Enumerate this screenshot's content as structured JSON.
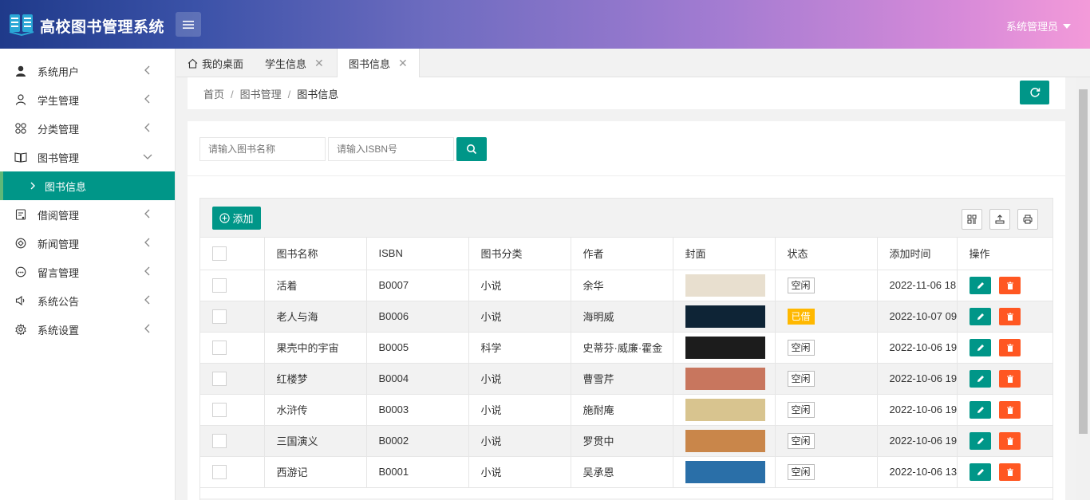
{
  "app": {
    "title": "高校图书管理系统",
    "user": "系统管理员"
  },
  "sidebar": {
    "items": [
      {
        "label": "系统用户",
        "icon": "user-icon"
      },
      {
        "label": "学生管理",
        "icon": "user-outline-icon"
      },
      {
        "label": "分类管理",
        "icon": "grid-icon"
      },
      {
        "label": "图书管理",
        "icon": "book-icon",
        "expanded": true
      },
      {
        "label": "图书信息",
        "icon": "chevron-right-icon",
        "active": true
      },
      {
        "label": "借阅管理",
        "icon": "form-icon"
      },
      {
        "label": "新闻管理",
        "icon": "news-icon"
      },
      {
        "label": "留言管理",
        "icon": "message-icon"
      },
      {
        "label": "系统公告",
        "icon": "speaker-icon"
      },
      {
        "label": "系统设置",
        "icon": "gear-icon"
      }
    ]
  },
  "tabs": [
    {
      "label": "我的桌面",
      "icon": "home-icon"
    },
    {
      "label": "学生信息",
      "closable": true
    },
    {
      "label": "图书信息",
      "closable": true,
      "active": true
    }
  ],
  "breadcrumb": {
    "home": "首页",
    "parent": "图书管理",
    "current": "图书信息",
    "separator": "/"
  },
  "search": {
    "name_placeholder": "请输入图书名称",
    "isbn_placeholder": "请输入ISBN号"
  },
  "toolbar": {
    "add_label": "添加"
  },
  "table": {
    "headers": [
      "图书名称",
      "ISBN",
      "图书分类",
      "作者",
      "封面",
      "状态",
      "添加时间",
      "操作"
    ],
    "rows": [
      {
        "name": "活着",
        "isbn": "B0007",
        "category": "小说",
        "author": "余华",
        "status": "空闲",
        "time": "2022-11-06 18:",
        "cover_color": "#e8dfcf"
      },
      {
        "name": "老人与海",
        "isbn": "B0006",
        "category": "小说",
        "author": "海明威",
        "status": "已借",
        "time": "2022-10-07 09:",
        "cover_color": "#0e2436"
      },
      {
        "name": "果壳中的宇宙",
        "isbn": "B0005",
        "category": "科学",
        "author": "史蒂芬·威廉·霍金",
        "status": "空闲",
        "time": "2022-10-06 19:",
        "cover_color": "#1c1c1c"
      },
      {
        "name": "红楼梦",
        "isbn": "B0004",
        "category": "小说",
        "author": "曹雪芹",
        "status": "空闲",
        "time": "2022-10-06 19:",
        "cover_color": "#c8765e"
      },
      {
        "name": "水浒传",
        "isbn": "B0003",
        "category": "小说",
        "author": "施耐庵",
        "status": "空闲",
        "time": "2022-10-06 19:",
        "cover_color": "#d8c48f"
      },
      {
        "name": "三国演义",
        "isbn": "B0002",
        "category": "小说",
        "author": "罗贯中",
        "status": "空闲",
        "time": "2022-10-06 19:",
        "cover_color": "#c9864a"
      },
      {
        "name": "西游记",
        "isbn": "B0001",
        "category": "小说",
        "author": "吴承恩",
        "status": "空闲",
        "time": "2022-10-06 13:",
        "cover_color": "#2a6fa8"
      }
    ]
  },
  "colors": {
    "primary": "#009688",
    "danger": "#ff5722",
    "warning": "#ffb800"
  }
}
